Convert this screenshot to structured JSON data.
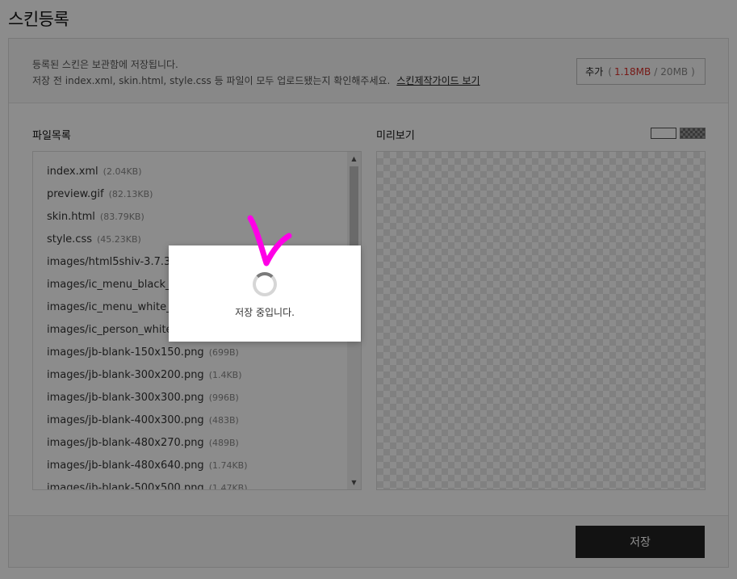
{
  "page": {
    "title": "스킨등록"
  },
  "notice": {
    "line1": "등록된 스킨은 보관함에 저장됩니다.",
    "line2": "저장 전 index.xml, skin.html, style.css 등 파일이 모두 업로드됐는지 확인해주세요.",
    "guide_link": "스킨제작가이드 보기"
  },
  "add_button": {
    "label": "추가",
    "open": "(",
    "used": "1.18MB",
    "sep": "/",
    "total": "20MB",
    "close": ")"
  },
  "file_list": {
    "label": "파일목록",
    "items": [
      {
        "name": "index.xml",
        "size": "(2.04KB)"
      },
      {
        "name": "preview.gif",
        "size": "(82.13KB)"
      },
      {
        "name": "skin.html",
        "size": "(83.79KB)"
      },
      {
        "name": "style.css",
        "size": "(45.23KB)"
      },
      {
        "name": "images/html5shiv-3.7.3.m",
        "size": ""
      },
      {
        "name": "images/ic_menu_black_4",
        "size": ""
      },
      {
        "name": "images/ic_menu_white_4",
        "size": ""
      },
      {
        "name": "images/ic_person_white_",
        "size": ""
      },
      {
        "name": "images/jb-blank-150x150.png",
        "size": "(699B)"
      },
      {
        "name": "images/jb-blank-300x200.png",
        "size": "(1.4KB)"
      },
      {
        "name": "images/jb-blank-300x300.png",
        "size": "(996B)"
      },
      {
        "name": "images/jb-blank-400x300.png",
        "size": "(483B)"
      },
      {
        "name": "images/jb-blank-480x270.png",
        "size": "(489B)"
      },
      {
        "name": "images/jb-blank-480x640.png",
        "size": "(1.74KB)"
      },
      {
        "name": "images/jb-blank-500x500.png",
        "size": "(1.47KB)"
      }
    ]
  },
  "preview": {
    "label": "미리보기"
  },
  "footer": {
    "save_label": "저장"
  },
  "modal": {
    "message": "저장 중입니다."
  }
}
